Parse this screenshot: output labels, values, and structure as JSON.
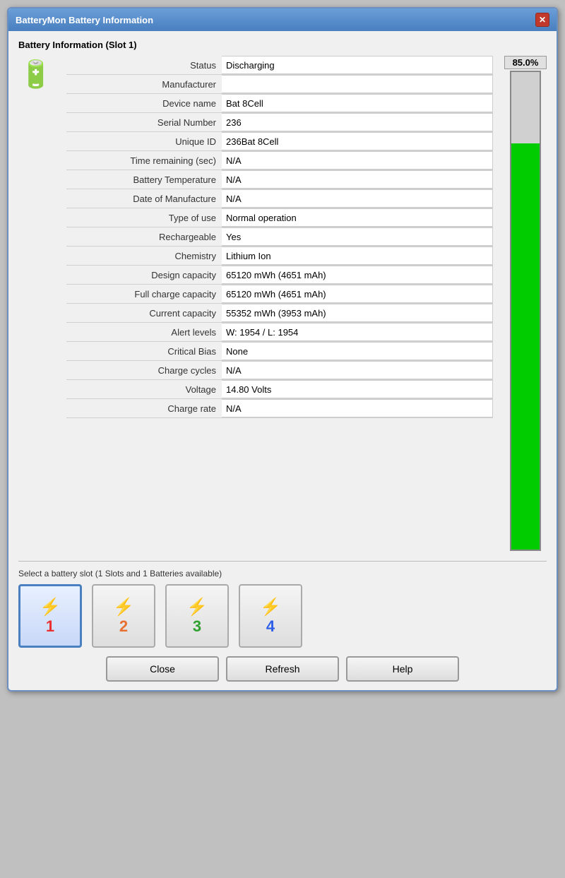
{
  "window": {
    "title": "BatteryMon Battery Information",
    "close_label": "✕"
  },
  "section": {
    "title": "Battery Information (Slot 1)"
  },
  "gauge": {
    "percent": "85.0%",
    "fill_percent": 85
  },
  "fields": [
    {
      "label": "Status",
      "value": "Discharging"
    },
    {
      "label": "Manufacturer",
      "value": ""
    },
    {
      "label": "Device name",
      "value": "Bat 8Cell"
    },
    {
      "label": "Serial Number",
      "value": "236"
    },
    {
      "label": "Unique ID",
      "value": "236Bat 8Cell"
    },
    {
      "label": "Time remaining (sec)",
      "value": "N/A"
    },
    {
      "label": "Battery Temperature",
      "value": "N/A"
    },
    {
      "label": "Date of Manufacture",
      "value": "N/A"
    },
    {
      "label": "Type of use",
      "value": "Normal operation"
    },
    {
      "label": "Rechargeable",
      "value": "Yes"
    },
    {
      "label": "Chemistry",
      "value": "Lithium Ion"
    },
    {
      "label": "Design capacity",
      "value": "65120 mWh (4651 mAh)"
    },
    {
      "label": "Full charge capacity",
      "value": "65120 mWh (4651 mAh)"
    },
    {
      "label": "Current capacity",
      "value": "55352 mWh (3953 mAh)"
    },
    {
      "label": "Alert levels",
      "value": "W: 1954 / L: 1954"
    },
    {
      "label": "Critical Bias",
      "value": "None"
    },
    {
      "label": "Charge cycles",
      "value": "N/A"
    },
    {
      "label": "Voltage",
      "value": "14.80 Volts"
    },
    {
      "label": "Charge rate",
      "value": "N/A"
    }
  ],
  "slots": {
    "label": "Select a battery slot (1 Slots and 1 Batteries available)",
    "buttons": [
      {
        "number": "1",
        "active": true
      },
      {
        "number": "2",
        "active": false
      },
      {
        "number": "3",
        "active": false
      },
      {
        "number": "4",
        "active": false
      }
    ]
  },
  "actions": {
    "close": "Close",
    "refresh": "Refresh",
    "help": "Help"
  }
}
